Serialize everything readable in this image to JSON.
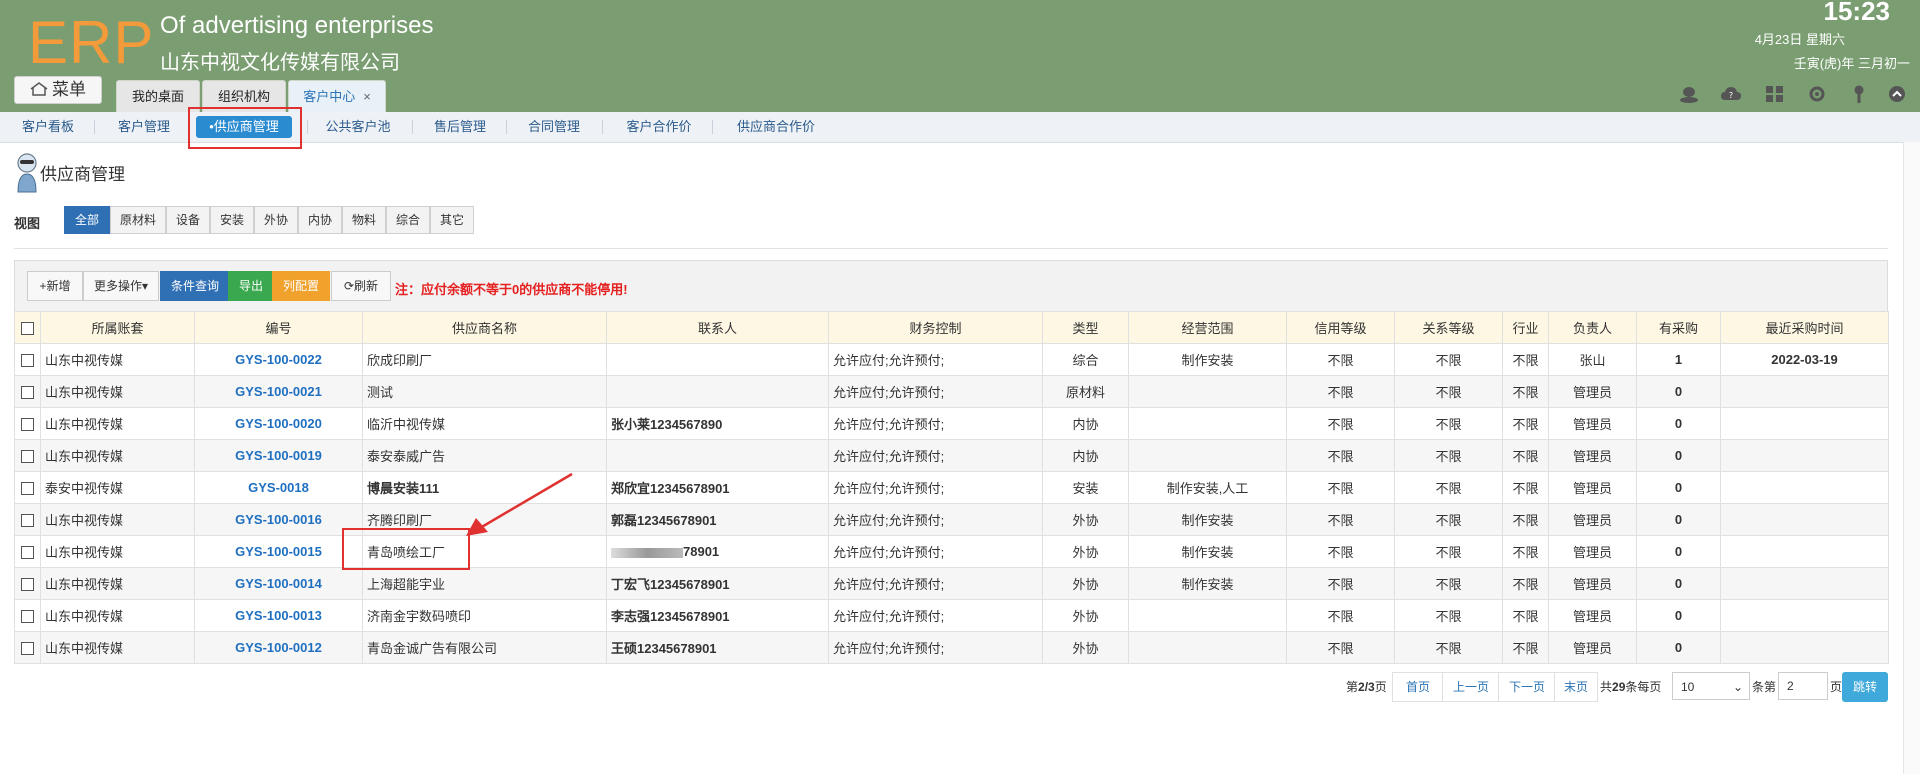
{
  "header": {
    "logo": "ERP",
    "brand_en": "Of advertising enterprises",
    "brand_cn": "山东中视文化传媒有限公司",
    "time": "15:23",
    "date": "4月23日 星期六",
    "lunar": "壬寅(虎)年 三月初一",
    "menu_label": "菜单",
    "tabs": [
      {
        "label": "我的桌面"
      },
      {
        "label": "组织机构"
      },
      {
        "label": "客户中心",
        "close": "×"
      }
    ]
  },
  "subnav": {
    "items": [
      "客户看板",
      "客户管理",
      "•供应商管理",
      "公共客户池",
      "售后管理",
      "合同管理",
      "客户合作价",
      "供应商合作价"
    ]
  },
  "page": {
    "title": "供应商管理",
    "view_label": "视图",
    "view_tabs": [
      "全部",
      "原材料",
      "设备",
      "安装",
      "外协",
      "内协",
      "物料",
      "综合",
      "其它"
    ]
  },
  "toolbar": {
    "new": "+新增",
    "more": "更多操作▾",
    "query": "条件查询",
    "export": "导出",
    "columns": "列配置",
    "refresh": "刷新",
    "note": "注：应付余额不等于0的供应商不能停用!"
  },
  "table": {
    "headers": [
      "所属账套",
      "编号",
      "供应商名称",
      "联系人",
      "财务控制",
      "类型",
      "经营范围",
      "信用等级",
      "关系等级",
      "行业",
      "负责人",
      "有采购",
      "最近采购时间"
    ],
    "rows": [
      [
        "山东中视传媒",
        "GYS-100-0022",
        "欣成印刷厂",
        "",
        "允许应付;允许预付;",
        "综合",
        "制作安装",
        "不限",
        "不限",
        "不限",
        "张山",
        "1",
        "2022-03-19"
      ],
      [
        "山东中视传媒",
        "GYS-100-0021",
        "测试",
        "",
        "允许应付;允许预付;",
        "原材料",
        "",
        "不限",
        "不限",
        "不限",
        "管理员",
        "0",
        ""
      ],
      [
        "山东中视传媒",
        "GYS-100-0020",
        "临沂中视传媒",
        "张小莱1234567890",
        "允许应付;允许预付;",
        "内协",
        "",
        "不限",
        "不限",
        "不限",
        "管理员",
        "0",
        ""
      ],
      [
        "山东中视传媒",
        "GYS-100-0019",
        "泰安泰威广告",
        "",
        "允许应付;允许预付;",
        "内协",
        "",
        "不限",
        "不限",
        "不限",
        "管理员",
        "0",
        ""
      ],
      [
        "泰安中视传媒",
        "GYS-0018",
        "博晨安装111",
        "郑欣宜12345678901",
        "允许应付;允许预付;",
        "安装",
        "制作安装,人工",
        "不限",
        "不限",
        "不限",
        "管理员",
        "0",
        ""
      ],
      [
        "山东中视传媒",
        "GYS-100-0016",
        "齐腾印刷厂",
        "郭磊12345678901",
        "允许应付;允许预付;",
        "外协",
        "制作安装",
        "不限",
        "不限",
        "不限",
        "管理员",
        "0",
        ""
      ],
      [
        "山东中视传媒",
        "GYS-100-0015",
        "青岛喷绘工厂",
        "78901",
        "允许应付;允许预付;",
        "外协",
        "制作安装",
        "不限",
        "不限",
        "不限",
        "管理员",
        "0",
        ""
      ],
      [
        "山东中视传媒",
        "GYS-100-0014",
        "上海超能宇业",
        "丁宏飞12345678901",
        "允许应付;允许预付;",
        "外协",
        "制作安装",
        "不限",
        "不限",
        "不限",
        "管理员",
        "0",
        ""
      ],
      [
        "山东中视传媒",
        "GYS-100-0013",
        "济南金宇数码喷印",
        "李志强12345678901",
        "允许应付;允许预付;",
        "外协",
        "",
        "不限",
        "不限",
        "不限",
        "管理员",
        "0",
        ""
      ],
      [
        "山东中视传媒",
        "GYS-100-0012",
        "青岛金诚广告有限公司",
        "王硕12345678901",
        "允许应付;允许预付;",
        "外协",
        "",
        "不限",
        "不限",
        "不限",
        "管理员",
        "0",
        ""
      ]
    ]
  },
  "pager": {
    "page_prefix": "第",
    "page_value": "2/3",
    "page_suffix": "页",
    "first": "首页",
    "prev": "上一页",
    "next": "下一页",
    "last": "末页",
    "total_prefix": "共",
    "total_value": "29",
    "total_suffix": "条每页",
    "page_size": "10",
    "goto_prefix": "条第",
    "goto_value": "2",
    "goto_suffix": "页",
    "go": "跳转"
  },
  "colors": {
    "header_bg": "#7a9e71",
    "logo": "#f39a3a",
    "accent_blue": "#2f6fb4",
    "highlight_red": "#e03030"
  }
}
